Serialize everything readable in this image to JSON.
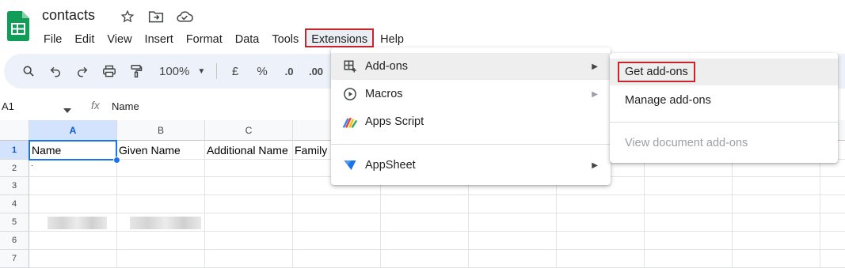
{
  "doc": {
    "title": "contacts"
  },
  "menubar": [
    "File",
    "Edit",
    "View",
    "Insert",
    "Format",
    "Data",
    "Tools",
    "Extensions",
    "Help"
  ],
  "toolbar": {
    "zoom": "100%",
    "currency": "£",
    "percent": "%",
    "dec_decrease": ".0",
    "dec_increase": ".00"
  },
  "formula": {
    "cell_ref": "A1",
    "fx": "fx",
    "value": "Name"
  },
  "columns": [
    "A",
    "B",
    "C"
  ],
  "rows": [
    "1",
    "2",
    "3",
    "4",
    "5",
    "6",
    "7"
  ],
  "cells": {
    "a1": "Name",
    "b1": "Given Name",
    "c1": "Additional Name",
    "d1": "Family",
    "a2": "."
  },
  "extensions_menu": {
    "addons": "Add-ons",
    "macros": "Macros",
    "apps_script": "Apps Script",
    "appsheet": "AppSheet"
  },
  "addons_submenu": {
    "get": "Get add-ons",
    "manage": "Manage add-ons",
    "view": "View document add-ons"
  },
  "icons": [
    "sheets-logo",
    "star-icon",
    "move-folder-icon",
    "cloud-saved-icon",
    "search-icon",
    "undo-icon",
    "redo-icon",
    "print-icon",
    "paint-format-icon",
    "addons-icon",
    "macros-play-icon",
    "apps-script-icon",
    "appsheet-icon"
  ],
  "colors": {
    "highlight_border": "#c9252d",
    "toolbar_bg": "#edf2fa",
    "selection": "#1a73e8"
  }
}
